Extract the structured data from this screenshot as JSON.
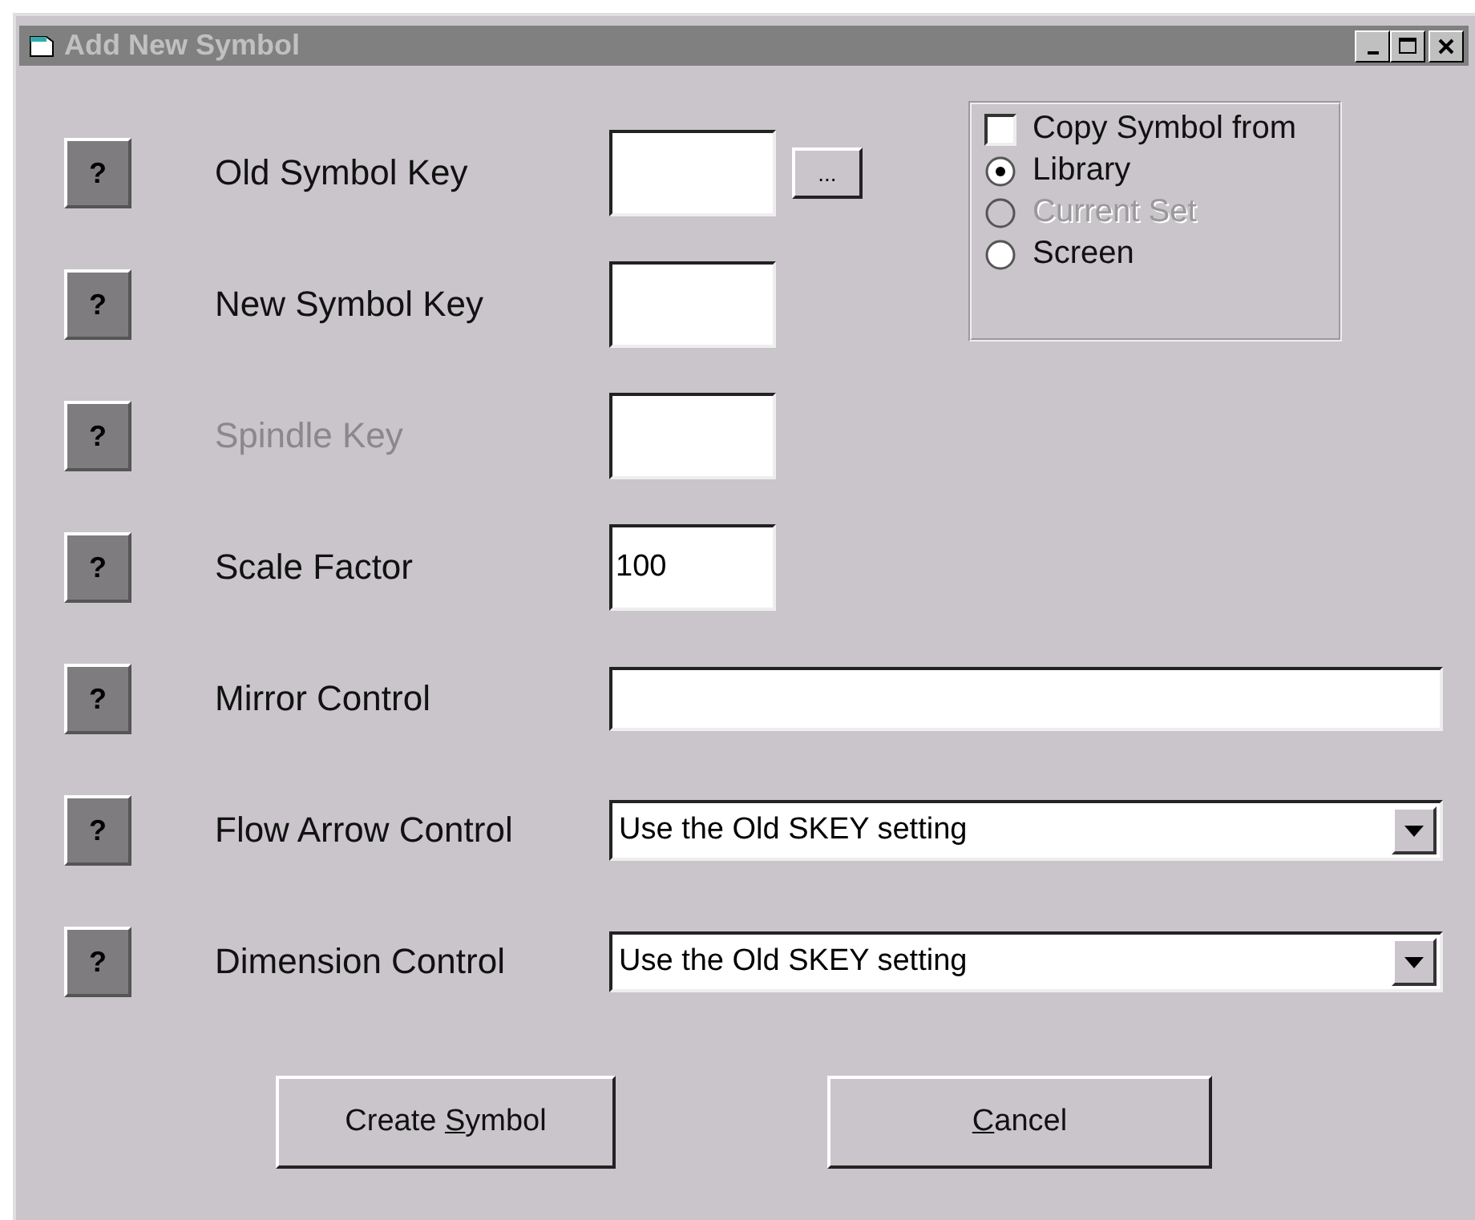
{
  "window": {
    "title": "Add New Symbol"
  },
  "fields": [
    {
      "kind": "small",
      "help": "?",
      "label": "Old Symbol Key",
      "disabled": false,
      "browse": "..."
    },
    {
      "kind": "small",
      "help": "?",
      "label": "New Symbol Key",
      "disabled": false
    },
    {
      "kind": "small",
      "help": "?",
      "label": "Spindle Key",
      "disabled": true
    },
    {
      "kind": "small",
      "help": "?",
      "label": "Scale Factor",
      "disabled": false,
      "value": "100"
    },
    {
      "kind": "wide",
      "help": "?",
      "label": "Mirror Control",
      "disabled": false
    },
    {
      "kind": "combo",
      "help": "?",
      "label": "Flow Arrow Control",
      "disabled": false,
      "value": "Use the Old SKEY setting"
    },
    {
      "kind": "combo",
      "help": "?",
      "label": "Dimension Control",
      "disabled": false,
      "value": "Use the Old SKEY setting"
    }
  ],
  "copy_from": {
    "label": "Copy Symbol from",
    "checked": false,
    "options": [
      {
        "label": "Library",
        "selected": true,
        "disabled": false
      },
      {
        "label": "Current Set",
        "selected": false,
        "disabled": true
      },
      {
        "label": "Screen",
        "selected": false,
        "disabled": false
      }
    ]
  },
  "buttons": [
    {
      "text_before": "Create ",
      "access_key": "S",
      "text_after": "ymbol"
    },
    {
      "access_key": "C",
      "text_after": "ancel"
    }
  ]
}
